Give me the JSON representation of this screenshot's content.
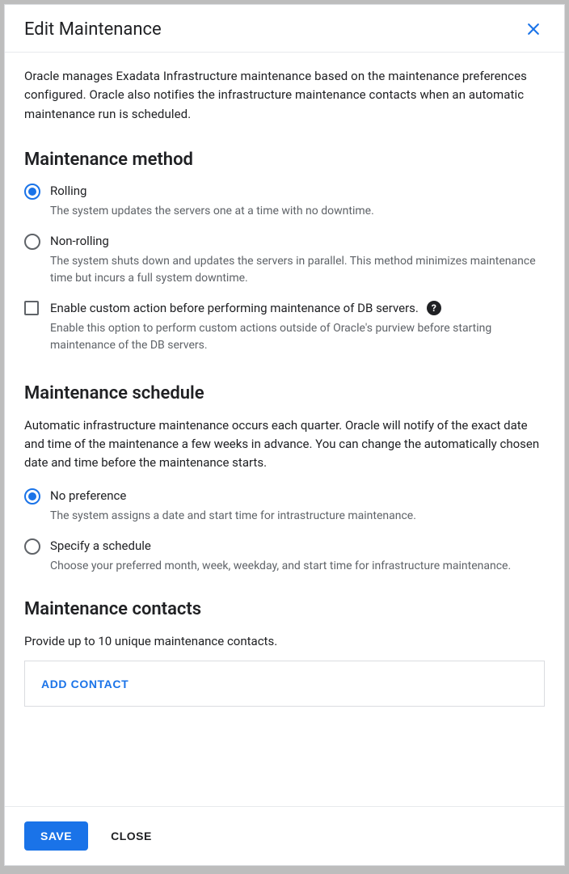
{
  "dialog": {
    "title": "Edit Maintenance",
    "intro": "Oracle manages Exadata Infrastructure maintenance based on the maintenance preferences configured. Oracle also notifies the infrastructure maintenance contacts when an automatic maintenance run is scheduled."
  },
  "method": {
    "heading": "Maintenance method",
    "rolling": {
      "label": "Rolling",
      "desc": "The system updates the servers one at a time with no downtime."
    },
    "nonrolling": {
      "label": "Non-rolling",
      "desc": "The system shuts down and updates the servers in parallel. This method minimizes maintenance time but incurs a full system downtime."
    },
    "custom_action": {
      "label": "Enable custom action before performing maintenance of DB servers.",
      "desc": "Enable this option to perform custom actions outside of Oracle's purview before starting maintenance of the DB servers."
    }
  },
  "schedule": {
    "heading": "Maintenance schedule",
    "desc": "Automatic infrastructure maintenance occurs each quarter. Oracle will notify of the exact date and time of the maintenance a few weeks in advance. You can change the automatically chosen date and time before the maintenance starts.",
    "no_pref": {
      "label": "No preference",
      "desc": "The system assigns a date and start time for intrastructure maintenance."
    },
    "specify": {
      "label": "Specify a schedule",
      "desc": "Choose your preferred month, week, weekday, and start time for infrastructure maintenance."
    }
  },
  "contacts": {
    "heading": "Maintenance contacts",
    "desc": "Provide up to 10 unique maintenance contacts.",
    "add_label": "ADD CONTACT"
  },
  "footer": {
    "save": "SAVE",
    "close": "CLOSE"
  }
}
